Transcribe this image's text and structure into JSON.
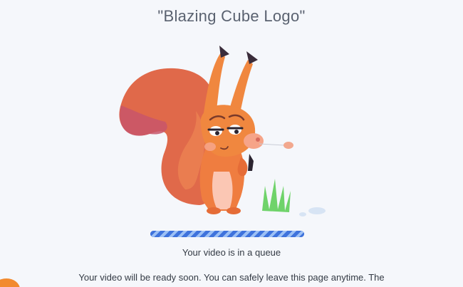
{
  "header": {
    "title": "\"Blazing Cube Logo\""
  },
  "queue": {
    "progress_fraction": 1.0,
    "status_text": "Your video is in a queue",
    "description_text": "Your video will be ready soon. You can safely leave this page anytime. The"
  },
  "colors": {
    "progress_blue": "#3f73dc",
    "progress_light": "#9cc0f5",
    "squirrel_orange": "#ec7b44",
    "grass_green": "#6fd36a",
    "chat_orange": "#f28a2e"
  },
  "icons": {
    "illustration": "squirrel-illustration",
    "corner": "chat-widget-icon"
  }
}
